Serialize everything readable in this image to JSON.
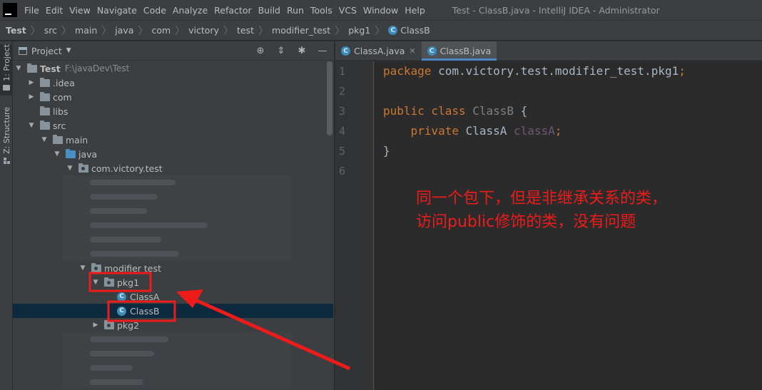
{
  "titlebar": {
    "logo": "IJ",
    "menu": [
      "File",
      "Edit",
      "View",
      "Navigate",
      "Code",
      "Analyze",
      "Refactor",
      "Build",
      "Run",
      "Tools",
      "VCS",
      "Window",
      "Help"
    ],
    "window_title": "Test - ClassB.java - IntelliJ IDEA - Administrator"
  },
  "breadcrumbs": [
    "Test",
    "src",
    "main",
    "java",
    "com",
    "victory",
    "test",
    "modifier_test",
    "pkg1",
    "ClassB"
  ],
  "toolstrip": {
    "project_tab": "1: Project",
    "structure_tab": "Z: Structure"
  },
  "project_panel": {
    "title": "Project",
    "tree": [
      {
        "label": "Test",
        "path": "F:\\javaDev\\Test",
        "arrow": "expanded",
        "icon": "project-folder-icon"
      },
      {
        "label": ".idea",
        "arrow": "collapsed",
        "icon": "folder-icon"
      },
      {
        "label": "com",
        "arrow": "collapsed",
        "icon": "folder-icon"
      },
      {
        "label": "libs",
        "arrow": "none",
        "icon": "folder-icon"
      },
      {
        "label": "src",
        "arrow": "expanded",
        "icon": "folder-icon"
      },
      {
        "label": "main",
        "arrow": "expanded",
        "icon": "folder-icon"
      },
      {
        "label": "java",
        "arrow": "expanded",
        "icon": "source-folder-icon"
      },
      {
        "label": "com.victory.test",
        "arrow": "expanded",
        "icon": "package-icon"
      },
      {
        "label": "modifier test",
        "arrow": "expanded",
        "icon": "package-icon"
      },
      {
        "label": "pkg1",
        "arrow": "expanded",
        "icon": "package-icon"
      },
      {
        "label": "ClassA",
        "arrow": "none",
        "icon": "class-icon"
      },
      {
        "label": "ClassB",
        "arrow": "none",
        "icon": "class-icon"
      },
      {
        "label": "pkg2",
        "arrow": "collapsed",
        "icon": "package-icon"
      }
    ]
  },
  "editor": {
    "tabs": [
      {
        "label": "ClassA.java",
        "active": false
      },
      {
        "label": "ClassB.java",
        "active": true
      }
    ],
    "line_numbers": [
      "1",
      "2",
      "3",
      "4",
      "5",
      "6"
    ],
    "code": {
      "l1_kw": "package",
      "l1_rest": " com.victory.test.modifier_test.pkg1",
      "l1_semi": ";",
      "l3_kw": "public class",
      "l3_name": " ClassB",
      "l3_brace": " {",
      "l4_indent": "    ",
      "l4_kw": "private",
      "l4_type": " ClassA",
      "l4_field": " classA",
      "l4_semi": ";",
      "l5": "}"
    }
  },
  "annotation": {
    "line1": "同一个包下，但是非继承关系的类，",
    "line2": "访问public修饰的类，没有问题",
    "color": "#ee1b1b"
  },
  "colors": {
    "keyword": "#cc7832",
    "selection": "#0d293e",
    "highlight_box": "#ee1b1b"
  }
}
